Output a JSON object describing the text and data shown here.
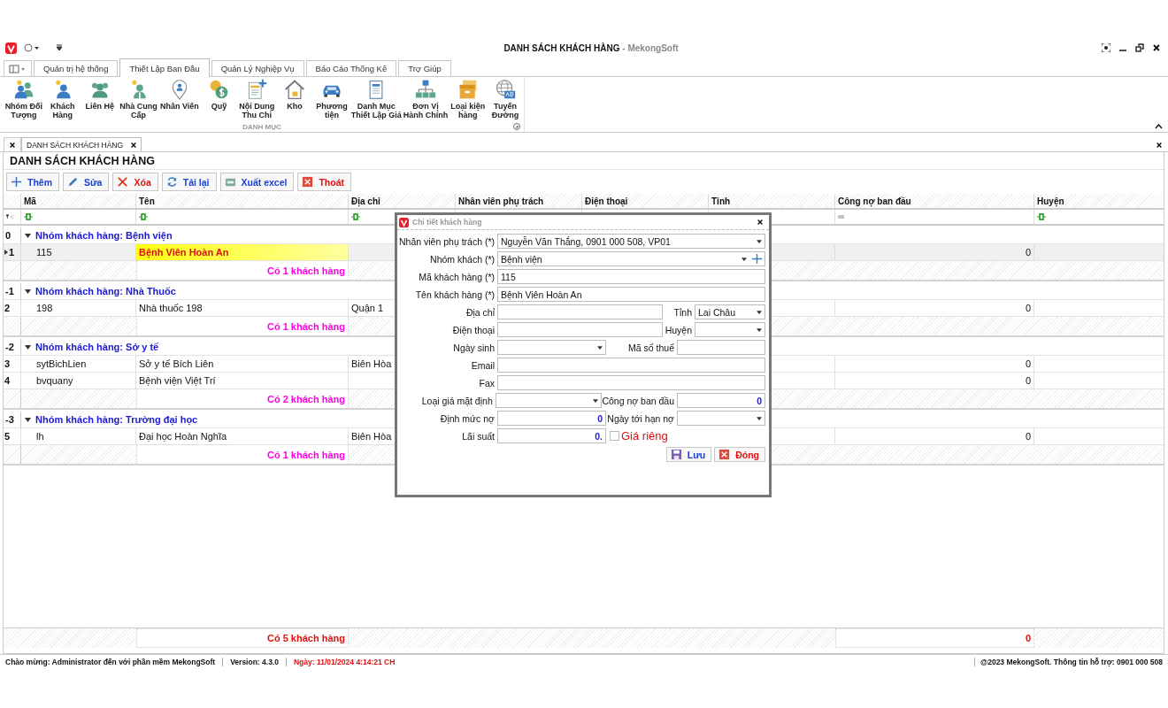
{
  "window": {
    "title": "DANH SÁCH KHÁCH HÀNG",
    "title_suffix": "- MekongSoft"
  },
  "ribbon_tabs": [
    {
      "label": "Quản trị hệ thống",
      "selected": false
    },
    {
      "label": "Thiết Lập Ban Đầu",
      "selected": true
    },
    {
      "label": "Quản Lý Nghiệp Vụ",
      "selected": false
    },
    {
      "label": "Báo Cáo Thống Kê",
      "selected": false
    },
    {
      "label": "Trợ Giúp",
      "selected": false
    }
  ],
  "ribbon": {
    "group_label": "DANH MỤC",
    "items": [
      {
        "label": "Nhóm Đối\nTượng",
        "kind": "people"
      },
      {
        "label": "Khách\nHàng",
        "kind": "person"
      },
      {
        "label": "Liên Hệ",
        "kind": "group"
      },
      {
        "label": "Nhà Cung\nCấp",
        "kind": "worker"
      },
      {
        "label": "Nhân Viên",
        "kind": "pin"
      },
      {
        "label": "Quỹ",
        "kind": "coins"
      },
      {
        "label": "Nội Dung\nThu Chi",
        "kind": "docplus"
      },
      {
        "label": "Kho",
        "kind": "house"
      },
      {
        "label": "Phương\ntiện",
        "kind": "car"
      },
      {
        "label": "Danh Mục\nThiết Lập Giá",
        "kind": "doc"
      },
      {
        "label": "Đơn Vị\nHành Chính",
        "kind": "org"
      },
      {
        "label": "Loại kiện\nhàng",
        "kind": "box"
      },
      {
        "label": "Tuyến\nĐường",
        "kind": "globe"
      }
    ]
  },
  "document_tabs": [
    {
      "label": "DANH SÁCH KHÁCH HÀNG",
      "selected": true
    }
  ],
  "panel": {
    "title": "DANH SÁCH KHÁCH HÀNG"
  },
  "toolbar": [
    {
      "label": "Thêm",
      "kind": "add"
    },
    {
      "label": "Sửa",
      "kind": "edit"
    },
    {
      "label": "Xóa",
      "kind": "delete"
    },
    {
      "label": "Tải lại",
      "kind": "reload"
    },
    {
      "label": "Xuất excel",
      "kind": "excel"
    },
    {
      "label": "Thoát",
      "kind": "exit"
    }
  ],
  "table": {
    "columns": [
      {
        "label": "Mã",
        "filter": {
          "kind": "contains"
        }
      },
      {
        "label": "Tên",
        "filter": {
          "kind": "contains"
        }
      },
      {
        "label": "Địa chỉ",
        "filter": {
          "kind": "contains"
        }
      },
      {
        "label": "Nhân viên phụ trách"
      },
      {
        "label": "Điện thoại"
      },
      {
        "label": "Tỉnh"
      },
      {
        "label": "Công nợ ban đầu",
        "filter": {
          "kind": "equals"
        }
      },
      {
        "label": "Huyện",
        "filter": {
          "kind": "contains"
        }
      }
    ],
    "groups": [
      {
        "index": "0",
        "label": "Nhóm khách hàng: Bệnh viện",
        "expanded": true,
        "summary": "Có 1 khách hàng",
        "rows": [
          {
            "index": "1",
            "selected": true,
            "code": "115",
            "name": "Bệnh Viên Hoàn An",
            "debt": "0"
          }
        ]
      },
      {
        "index": "-1",
        "label": "Nhóm khách hàng: Nhà Thuốc",
        "expanded": true,
        "summary": "Có 1 khách hàng",
        "rows": [
          {
            "index": "2",
            "selected": false,
            "code": "198",
            "name": "Nhà thuốc 198",
            "address": "Quận 1",
            "debt": "0"
          }
        ]
      },
      {
        "index": "-2",
        "label": "Nhóm khách hàng: Sở y tế",
        "expanded": true,
        "summary": "Có 2 khách hàng",
        "rows": [
          {
            "index": "3",
            "selected": false,
            "code": "sytBichLien",
            "name": "Sở y tế  Bích Liên",
            "address": "Biên Hòa",
            "debt": "0"
          },
          {
            "index": "4",
            "selected": false,
            "code": "bvquany",
            "name": "Bệnh viện Việt Trí",
            "debt": "0"
          }
        ]
      },
      {
        "index": "-3",
        "label": "Nhóm khách hàng: Trường đại học",
        "expanded": true,
        "summary": "Có 1 khách hàng",
        "rows": [
          {
            "index": "5",
            "selected": false,
            "code": "lh",
            "name": "Đại học Hoàn Nghĩa",
            "address": "Biên Hòa",
            "debt": "0"
          }
        ]
      }
    ],
    "footer": {
      "summary": "Có 5 khách hàng",
      "debt_total": "0"
    }
  },
  "dialog": {
    "title": "Chi tiết khách hàng",
    "rows": [
      {
        "fields": [
          {
            "label": "Nhân viên phụ trách (*)",
            "kind": "dropdown",
            "value": "Nguyễn Văn Thắng, 0901 000 508, VP01"
          }
        ]
      },
      {
        "fields": [
          {
            "label": "Nhóm khách (*)",
            "kind": "dropdown-add",
            "value": "Bệnh viện"
          }
        ]
      },
      {
        "fields": [
          {
            "label": "Mã khách hàng (*)",
            "kind": "text",
            "value": "115"
          }
        ]
      },
      {
        "fields": [
          {
            "label": "Tên khách hàng (*)",
            "kind": "text",
            "value": "Bệnh Viên Hoàn An"
          }
        ]
      },
      {
        "fields": [
          {
            "label": "Địa chỉ",
            "kind": "text"
          },
          {
            "label": "Tỉnh",
            "kind": "dropdown",
            "value": "Lai Châu"
          }
        ]
      },
      {
        "fields": [
          {
            "label": "Điện thoại",
            "kind": "text"
          },
          {
            "label": "Huyện",
            "kind": "dropdown"
          }
        ]
      },
      {
        "fields": [
          {
            "label": "Ngày sinh",
            "kind": "dropdown"
          },
          {
            "label": "Mã số thuế",
            "kind": "text"
          }
        ]
      },
      {
        "fields": [
          {
            "label": "Email",
            "kind": "text"
          }
        ]
      },
      {
        "fields": [
          {
            "label": "Fax",
            "kind": "text"
          }
        ]
      },
      {
        "fields": [
          {
            "label": "Loại giá mặt định",
            "kind": "dropdown"
          },
          {
            "label": "Công nợ ban đầu",
            "kind": "number",
            "value": "0"
          }
        ]
      },
      {
        "fields": [
          {
            "label": "Định mức nợ",
            "kind": "number",
            "value": "0"
          },
          {
            "label": "Ngày tới hạn nợ",
            "kind": "dropdown"
          }
        ]
      },
      {
        "fields": [
          {
            "label": "Lãi suất",
            "kind": "number",
            "value": "0."
          },
          {
            "label": "Giá riêng",
            "kind": "checkbox",
            "checked": false
          }
        ]
      }
    ],
    "buttons": [
      {
        "label": "Lưu",
        "kind": "save"
      },
      {
        "label": "Đóng",
        "kind": "close"
      }
    ]
  },
  "status_bar": {
    "welcome": "Chào mừng: Administrator đến với phần mềm MekongSoft",
    "version": "Version: 4.3.0",
    "date": "Ngày: 11/01/2024 4:14:21 CH",
    "copyright": "@2023 MekongSoft. Thông tin hỗ trợ: 0901 000 508"
  }
}
